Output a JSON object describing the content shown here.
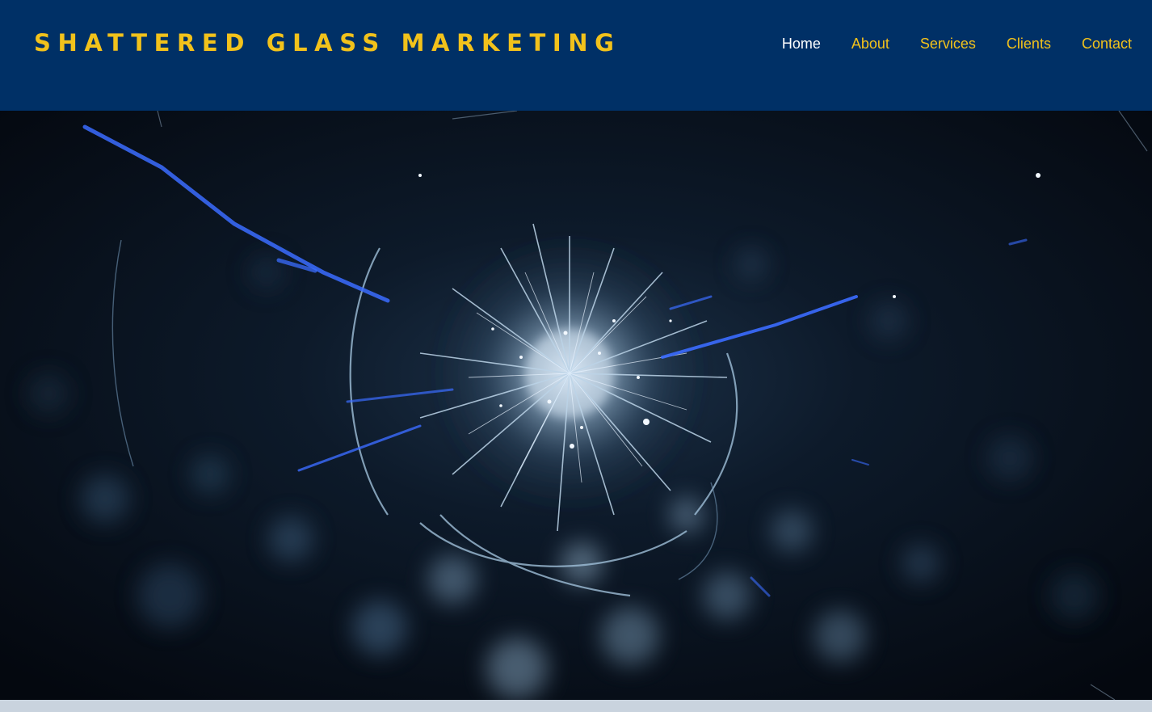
{
  "site": {
    "brand": "SHATTERED GLASS MARKETING",
    "colors": {
      "header_bg": "#003066",
      "brand_text": "#f2c21b",
      "nav_active": "#ffffff",
      "nav_inactive": "#f2c21b"
    }
  },
  "nav": {
    "items": [
      {
        "label": "Home",
        "active": true
      },
      {
        "label": "About",
        "active": false
      },
      {
        "label": "Services",
        "active": false
      },
      {
        "label": "Clients",
        "active": false
      },
      {
        "label": "Contact",
        "active": false
      }
    ]
  },
  "hero": {
    "image": "shattered-glass-impact",
    "tint": "#0a1426"
  }
}
